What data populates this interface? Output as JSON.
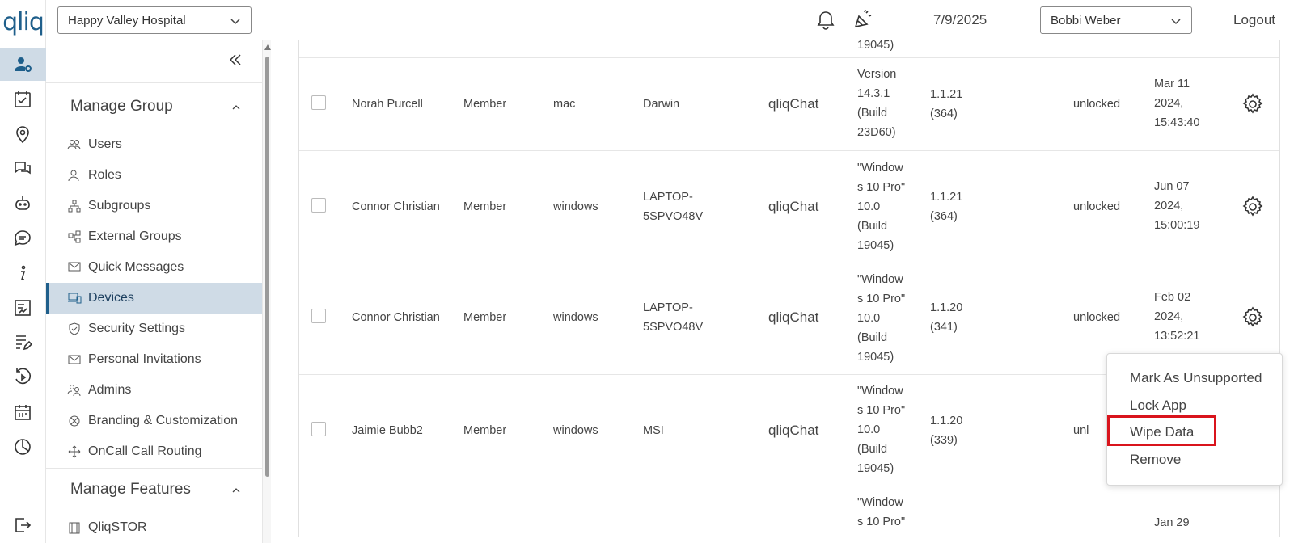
{
  "app": {
    "logo_text": "qliq"
  },
  "topbar": {
    "hospital": "Happy Valley Hospital",
    "date": "7/9/2025",
    "user": "Bobbi Weber",
    "logout": "Logout"
  },
  "rail_icons": [
    "user-settings-icon",
    "task-check-icon",
    "location-pin-icon",
    "chat-bubbles-icon",
    "bot-icon",
    "message-icon",
    "info-icon",
    "document-sign-icon",
    "form-edit-icon",
    "history-icon",
    "calendar-icon",
    "pie-chart-icon",
    "exit-icon"
  ],
  "sidebar": {
    "sections": [
      {
        "title": "Manage Group",
        "items": [
          {
            "label": "Users",
            "icon": "users-icon"
          },
          {
            "label": "Roles",
            "icon": "role-icon"
          },
          {
            "label": "Subgroups",
            "icon": "subgroups-icon"
          },
          {
            "label": "External Groups",
            "icon": "external-groups-icon"
          },
          {
            "label": "Quick Messages",
            "icon": "quick-messages-icon"
          },
          {
            "label": "Devices",
            "icon": "devices-icon"
          },
          {
            "label": "Security Settings",
            "icon": "shield-icon"
          },
          {
            "label": "Personal Invitations",
            "icon": "envelope-icon"
          },
          {
            "label": "Admins",
            "icon": "admins-icon"
          },
          {
            "label": "Branding & Customization",
            "icon": "branding-icon"
          },
          {
            "label": "OnCall Call Routing",
            "icon": "routing-icon"
          }
        ]
      },
      {
        "title": "Manage Features",
        "items": [
          {
            "label": "QliqSTOR",
            "icon": "storage-icon"
          }
        ]
      }
    ]
  },
  "table": {
    "top_partial": "19045)",
    "rows": [
      {
        "name": "Norah Purcell",
        "role": "Member",
        "os": "mac",
        "device": [
          "Darwin"
        ],
        "app": "qliqChat",
        "os_version": [
          "Version",
          "14.3.1",
          "(Build",
          "23D60)"
        ],
        "app_version": [
          "1.1.21",
          "(364)"
        ],
        "status": "unlocked",
        "date": [
          "Mar 11",
          "2024,",
          "15:43:40"
        ]
      },
      {
        "name": "Connor Christian",
        "role": "Member",
        "os": "windows",
        "device": [
          "LAPTOP-",
          "5SPVO48V"
        ],
        "app": "qliqChat",
        "os_version": [
          "\"Window",
          "s 10 Pro\"",
          "10.0",
          "(Build",
          "19045)"
        ],
        "app_version": [
          "1.1.21",
          "(364)"
        ],
        "status": "unlocked",
        "date": [
          "Jun 07",
          "2024,",
          "15:00:19"
        ]
      },
      {
        "name": "Connor Christian",
        "role": "Member",
        "os": "windows",
        "device": [
          "LAPTOP-",
          "5SPVO48V"
        ],
        "app": "qliqChat",
        "os_version": [
          "\"Window",
          "s 10 Pro\"",
          "10.0",
          "(Build",
          "19045)"
        ],
        "app_version": [
          "1.1.20",
          "(341)"
        ],
        "status": "unlocked",
        "date": [
          "Feb 02",
          "2024,",
          "13:52:21"
        ]
      },
      {
        "name": "Jaimie Bubb2",
        "role": "Member",
        "os": "windows",
        "device": [
          "MSI"
        ],
        "app": "qliqChat",
        "os_version": [
          "\"Window",
          "s 10 Pro\"",
          "10.0",
          "(Build",
          "19045)"
        ],
        "app_version": [
          "1.1.20",
          "(339)"
        ],
        "status": "unl",
        "date": []
      },
      {
        "name": "",
        "role": "",
        "os": "",
        "device": [],
        "app": "",
        "os_version": [
          "\"Window",
          "s 10 Pro\""
        ],
        "app_version": [],
        "status": "",
        "date": [
          "Jan 29"
        ]
      }
    ]
  },
  "context_menu": {
    "items": [
      "Mark As Unsupported",
      "Lock App",
      "Wipe Data",
      "Remove"
    ],
    "highlighted": "Wipe Data",
    "highlight_color": "#d9141c"
  },
  "colors": {
    "brand": "#1f5f8b",
    "active_bg": "#cfdbe6"
  }
}
